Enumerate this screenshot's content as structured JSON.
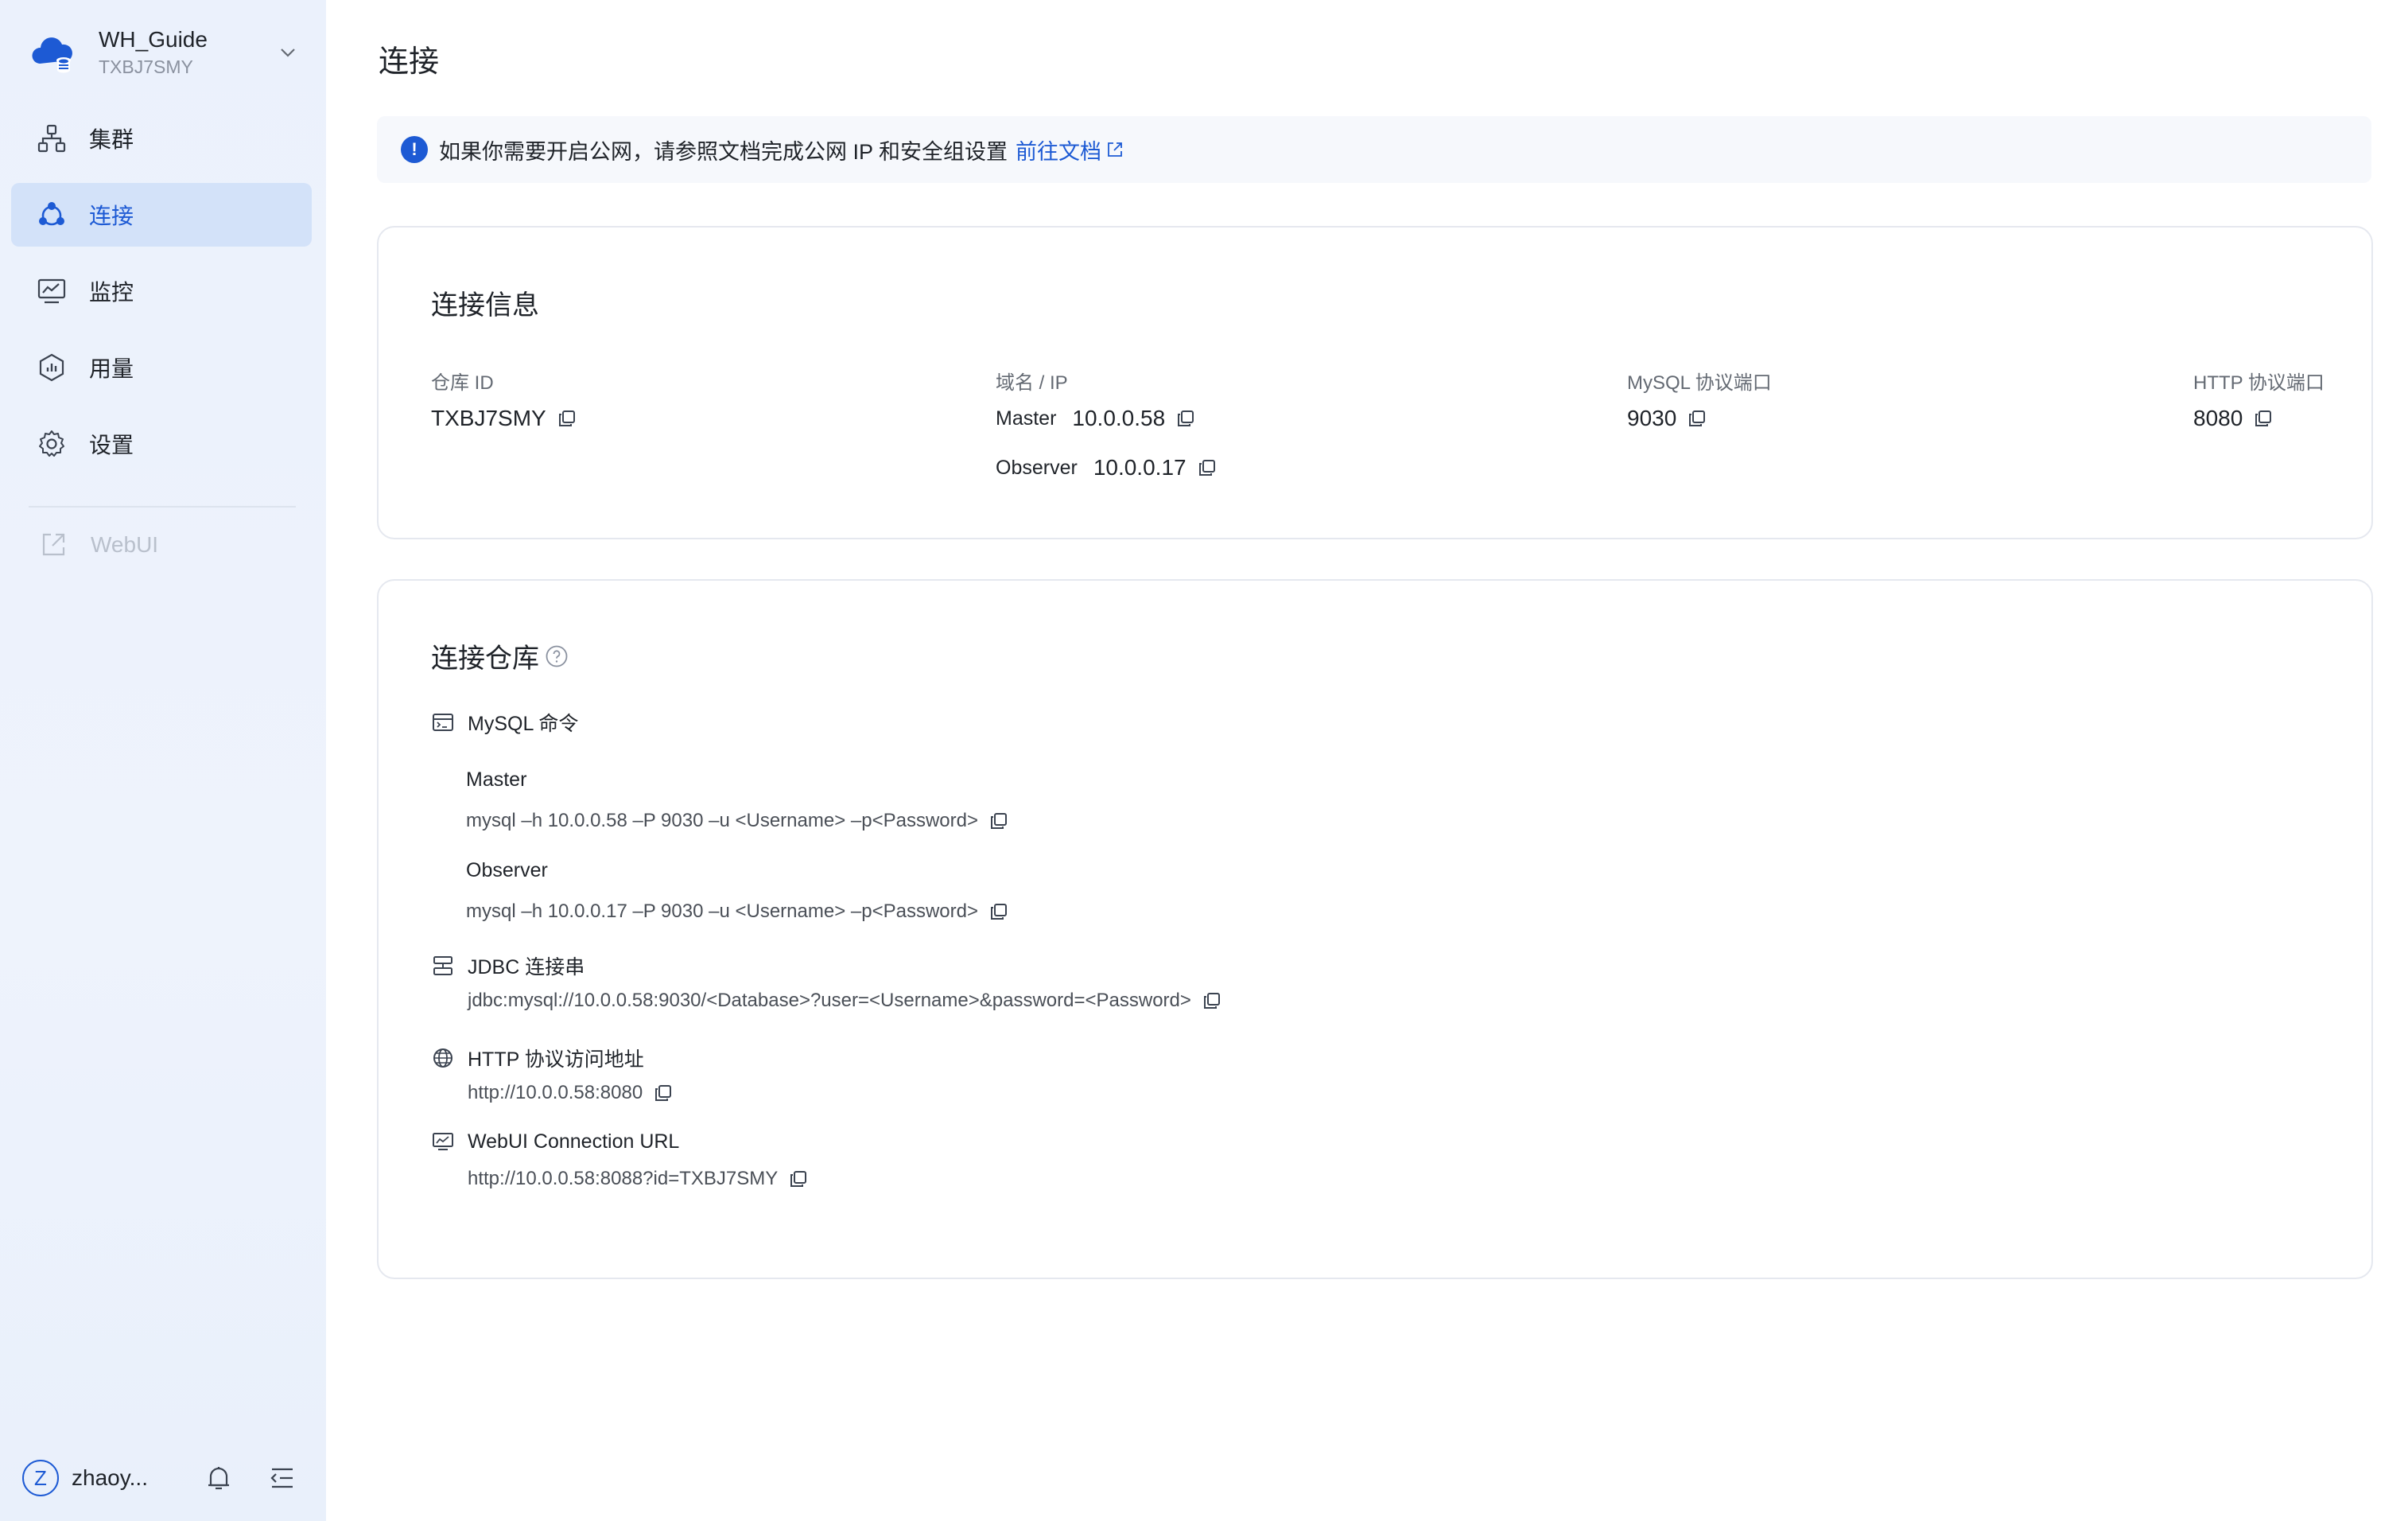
{
  "workspace": {
    "name": "WH_Guide",
    "id": "TXBJ7SMY",
    "logo_icon": "cloud-database-icon"
  },
  "sidebar": {
    "items": [
      {
        "label": "集群",
        "icon": "cluster-icon"
      },
      {
        "label": "连接",
        "icon": "connect-icon",
        "active": true
      },
      {
        "label": "监控",
        "icon": "monitor-icon"
      },
      {
        "label": "用量",
        "icon": "usage-icon"
      },
      {
        "label": "设置",
        "icon": "settings-icon"
      }
    ],
    "webui_label": "WebUI",
    "user_initial": "Z",
    "user_name": "zhaoy..."
  },
  "page": {
    "title": "连接"
  },
  "alert": {
    "text": "如果你需要开启公网，请参照文档完成公网 IP 和安全组设置",
    "link": "前往文档"
  },
  "connection_info": {
    "title": "连接信息",
    "warehouse_id_label": "仓库 ID",
    "warehouse_id": "TXBJ7SMY",
    "domain_label": "域名 / IP",
    "master_label": "Master",
    "master_ip": "10.0.0.58",
    "observer_label": "Observer",
    "observer_ip": "10.0.0.17",
    "mysql_port_label": "MySQL 协议端口",
    "mysql_port": "9030",
    "http_port_label": "HTTP 协议端口",
    "http_port": "8080"
  },
  "connect_warehouse": {
    "title": "连接仓库",
    "mysql_title": "MySQL 命令",
    "master_label": "Master",
    "master_cmd": "mysql –h 10.0.0.58 –P 9030 –u <Username> –p<Password>",
    "observer_label": "Observer",
    "observer_cmd": "mysql –h 10.0.0.17 –P 9030 –u <Username> –p<Password>",
    "jdbc_title": "JDBC 连接串",
    "jdbc_url": "jdbc:mysql://10.0.0.58:9030/<Database>?user=<Username>&password=<Password>",
    "http_title": "HTTP 协议访问地址",
    "http_url": "http://10.0.0.58:8080",
    "webui_title": "WebUI Connection URL",
    "webui_url": "http://10.0.0.58:8088?id=TXBJ7SMY"
  },
  "colors": {
    "accent": "#1d5ad4",
    "sidebar_bg": "#ebf1fc",
    "active_bg": "#d3e2f9",
    "border": "#e5e8ef"
  }
}
